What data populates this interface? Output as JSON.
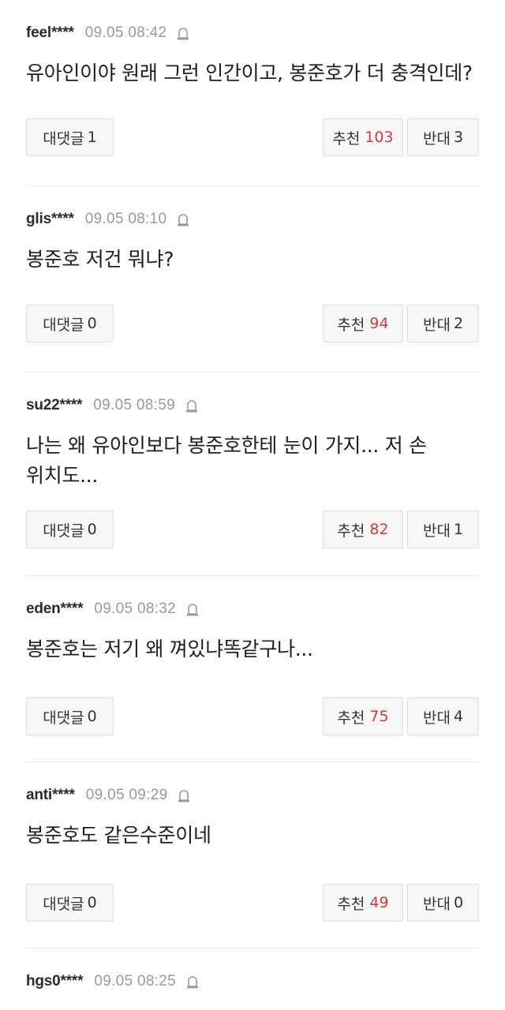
{
  "labels": {
    "reply": "대댓글",
    "like": "추천",
    "dislike": "반대"
  },
  "comments": [
    {
      "username": "feel****",
      "timestamp": "09.05 08:42",
      "text": "유아인이야 원래 그런 인간이고, 봉준호가 더 충격인데?",
      "replies": "1",
      "likes": "103",
      "dislikes": "3"
    },
    {
      "username": "glis****",
      "timestamp": "09.05 08:10",
      "text": "봉준호 저건 뭐냐?",
      "replies": "0",
      "likes": "94",
      "dislikes": "2"
    },
    {
      "username": "su22****",
      "timestamp": "09.05 08:59",
      "text": "나는 왜 유아인보다 봉준호한테 눈이 가지... 저 손 위치도...",
      "replies": "0",
      "likes": "82",
      "dislikes": "1"
    },
    {
      "username": "eden****",
      "timestamp": "09.05 08:32",
      "text": "봉준호는 저기 왜 껴있냐똑같구나...",
      "replies": "0",
      "likes": "75",
      "dislikes": "4"
    },
    {
      "username": "anti****",
      "timestamp": "09.05 09:29",
      "text": "봉준호도 같은수준이네",
      "replies": "0",
      "likes": "49",
      "dislikes": "0"
    },
    {
      "username": "hgs0****",
      "timestamp": "09.05 08:25",
      "text": ""
    }
  ],
  "icons": {
    "report": "report-bell-icon"
  },
  "colors": {
    "like_count": "#d23a3a",
    "timestamp": "#9a9a9a",
    "button_bg": "#f7f7f7"
  }
}
